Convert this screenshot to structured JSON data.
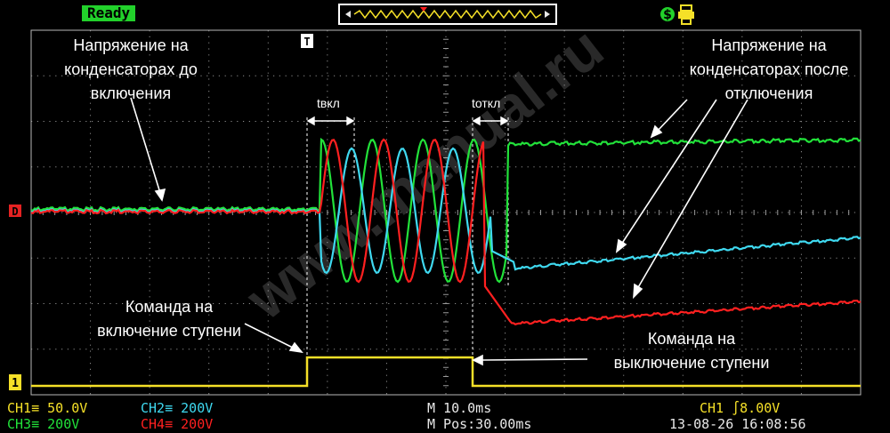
{
  "status": {
    "label": "Ready"
  },
  "trigger_marker": "T",
  "channel_markers": {
    "ch_ref": "D",
    "ch1": "1"
  },
  "annotations": {
    "before": [
      "Напряжение на",
      "конденсаторах до",
      "включения"
    ],
    "after": [
      "Напряжение на",
      "конденсаторах после",
      "отключения"
    ],
    "cmd_on": [
      "Команда на",
      "включение ступени"
    ],
    "cmd_off": [
      "Команда на",
      "выключение ступени"
    ],
    "t_on": "tвкл",
    "t_off": "tоткл"
  },
  "watermark": "www.manual.ru",
  "readout": {
    "ch1": "CH1≡ 50.0V",
    "ch2": "CH2≡ 200V",
    "ch3": "CH3≡ 200V",
    "ch4": "CH4≡ 200V",
    "timebase": "M 10.0ms",
    "mpos": "M Pos:30.00ms",
    "trigger": "CH1 ∫8.00V",
    "datetime": "13-08-26 16:08:56"
  },
  "colors": {
    "ch1": "#f5e028",
    "ch2": "#3fd9f0",
    "ch3": "#22e23a",
    "ch4": "#ff2020",
    "grid": "#b8b8b8",
    "ready_bg": "#22d12b",
    "ref_marker": "#e52222"
  },
  "icons": {
    "trigger_bar": "trigger-position-icon",
    "save": "save-icon",
    "printer": "printer-icon"
  }
}
